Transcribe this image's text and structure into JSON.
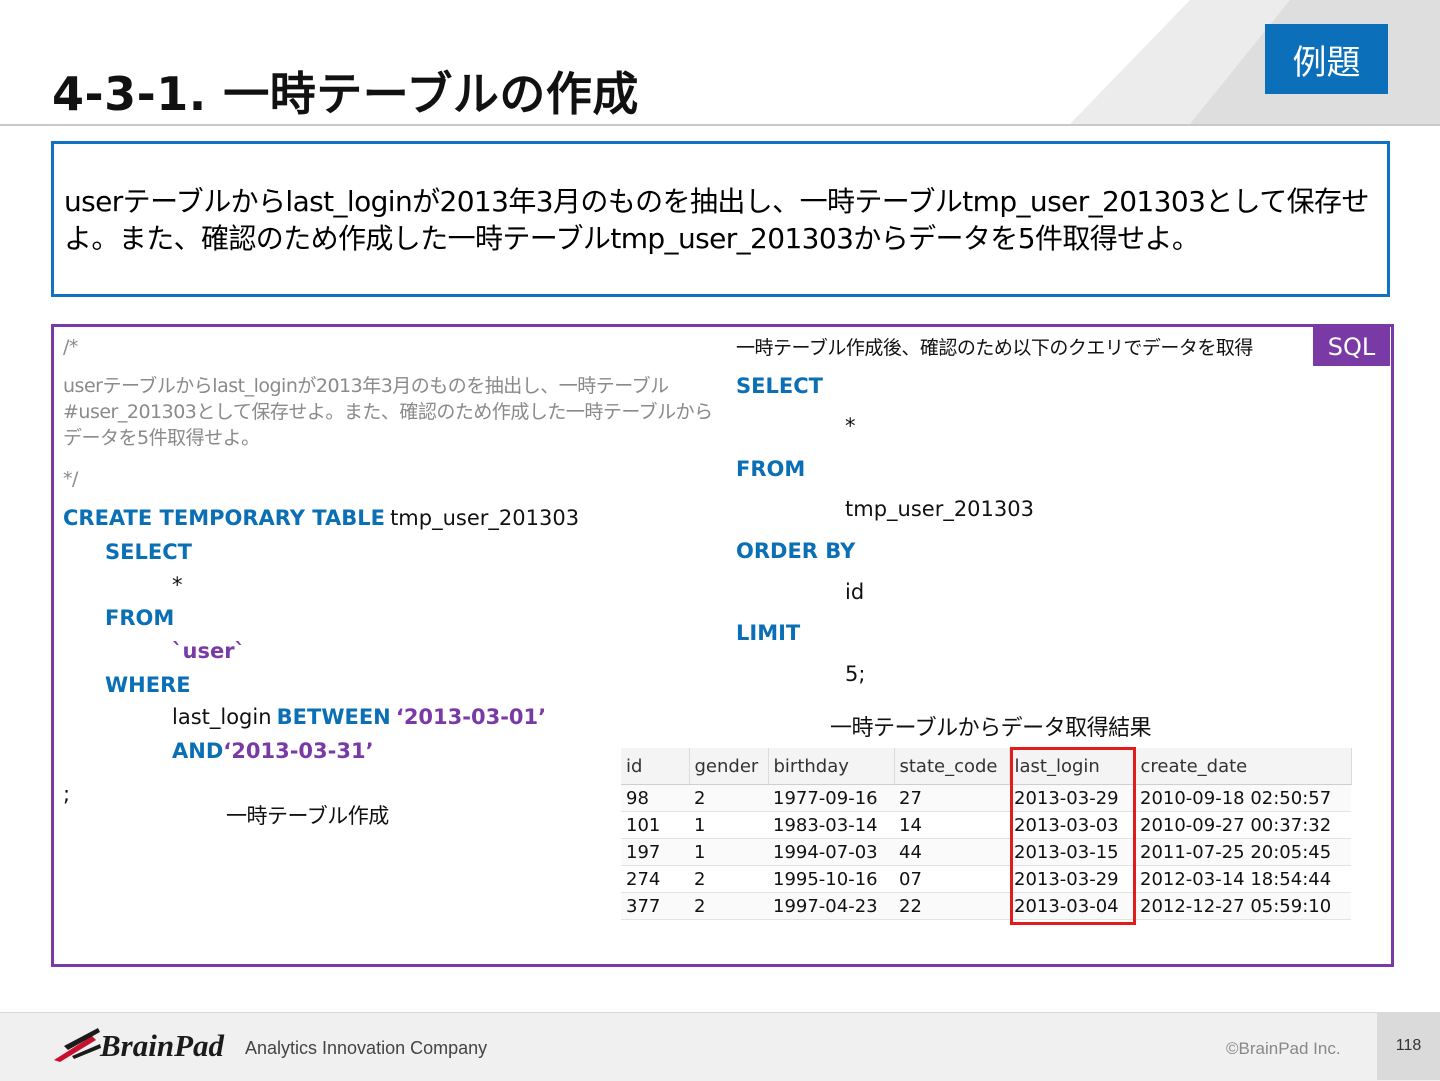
{
  "header": {
    "title": "4-3-1. 一時テーブルの作成",
    "badge": "例題"
  },
  "question": {
    "line1": "userテーブルからlast_loginが2013年3月のものを抽出し、一時テーブルtmp_user_201303として保存せ",
    "line2": "よ。また、確認のため作成した一時テーブルtmp_user_201303からデータを5件取得せよ。"
  },
  "sql_panel": {
    "label": "SQL",
    "comment_open": "/*",
    "comment_lines": [
      "userテーブルからlast_loginが2013年3月のものを抽出し、一時テーブル",
      "#user_201303として保存せよ。また、確認のため作成した一時テーブルから",
      "データを5件取得せよ。"
    ],
    "comment_close": "*/",
    "create_kw": "CREATE TEMPORARY TABLE",
    "create_table_name": "tmp_user_201303",
    "select_kw": "SELECT",
    "star": "*",
    "from_kw": "FROM",
    "from_table": "`user`",
    "where_kw": "WHERE",
    "where_col": "last_login",
    "between_kw": "BETWEEN",
    "date_start": "‘2013-03-01’",
    "and_kw": "AND",
    "date_end": "‘2013-03-31’",
    "terminator": ";",
    "create_caption": "一時テーブル作成",
    "query_caption": "一時テーブル作成後、確認のため以下のクエリでデータを取得",
    "q_select": "SELECT",
    "q_star": "*",
    "q_from": "FROM",
    "q_table": "tmp_user_201303",
    "q_order": "ORDER BY",
    "q_order_col": "id",
    "q_limit": "LIMIT",
    "q_limit_val": "5;",
    "result_caption": "一時テーブルからデータ取得結果"
  },
  "result_table": {
    "columns": [
      "id",
      "gender",
      "birthday",
      "state_code",
      "last_login",
      "create_date"
    ],
    "rows": [
      [
        "98",
        "2",
        "1977-09-16",
        "27",
        "2013-03-29",
        "2010-09-18 02:50:57"
      ],
      [
        "101",
        "1",
        "1983-03-14",
        "14",
        "2013-03-03",
        "2010-09-27 00:37:32"
      ],
      [
        "197",
        "1",
        "1994-07-03",
        "44",
        "2013-03-15",
        "2011-07-25 20:05:45"
      ],
      [
        "274",
        "2",
        "1995-10-16",
        "07",
        "2013-03-29",
        "2012-03-14 18:54:44"
      ],
      [
        "377",
        "2",
        "1997-04-23",
        "22",
        "2013-03-04",
        "2012-12-27 05:59:10"
      ]
    ],
    "highlight_color": "#e21b1b"
  },
  "footer": {
    "logo_text": "BrainPad",
    "tagline": "Analytics Innovation Company",
    "copyright": "©BrainPad Inc.",
    "page_number": "118"
  },
  "colors": {
    "accent_blue": "#0b6fba",
    "accent_purple": "#7a3aa6",
    "keyword_blue": "#0a6fb5"
  }
}
